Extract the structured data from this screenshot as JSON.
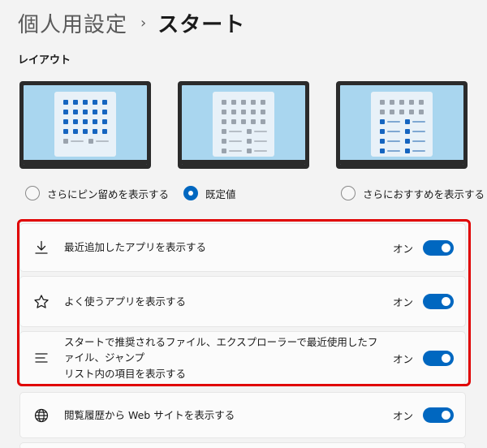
{
  "breadcrumb": {
    "parent": "個人用設定",
    "separator": "›",
    "current": "スタート"
  },
  "layout_section": {
    "label": "レイアウト",
    "options": [
      {
        "label": "さらにピン留めを表示する",
        "selected": false
      },
      {
        "label": "既定値",
        "selected": true
      },
      {
        "label": "さらにおすすめを表示する",
        "selected": false
      }
    ]
  },
  "settings": [
    {
      "icon": "download-icon",
      "label": "最近追加したアプリを表示する",
      "state": "オン",
      "on": true
    },
    {
      "icon": "star-icon",
      "label": "よく使うアプリを表示する",
      "state": "オン",
      "on": true
    },
    {
      "icon": "list-icon",
      "label_line1": "スタートで推奨されるファイル、エクスプローラーで最近使用したファイル、ジャンプ",
      "label_line2": "リスト内の項目を表示する",
      "state": "オン",
      "on": true
    },
    {
      "icon": "globe-icon",
      "label": "閲覧履歴から Web サイトを表示する",
      "state": "オン",
      "on": true
    }
  ],
  "colors": {
    "accent": "#0067c0",
    "highlight": "#e00000",
    "wallpaper": "#a9d6ef"
  }
}
